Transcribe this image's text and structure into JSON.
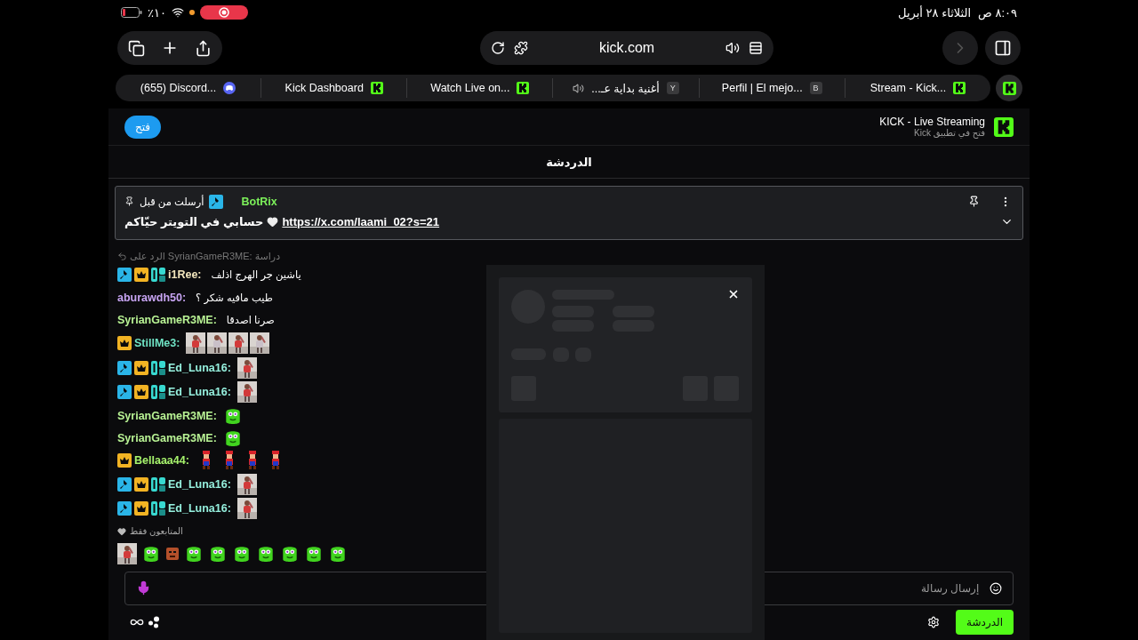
{
  "status_bar": {
    "time": "٨:٠٩ ص",
    "date": "الثلاثاء ٢٨ أبريل",
    "battery": "٪١٠",
    "recording": true
  },
  "toolbar": {
    "address": "kick.com",
    "forward_disabled": true
  },
  "tabs": [
    {
      "title": "Stream - Kick...",
      "audio": false,
      "favicon": {
        "kind": "kick"
      }
    },
    {
      "title": "Perfil | El mejo...",
      "audio": false,
      "favicon": {
        "kind": "letter",
        "text": "B"
      }
    },
    {
      "title": "أغنية بداية عـ...",
      "audio": true,
      "favicon": {
        "kind": "letter",
        "text": "Y"
      }
    },
    {
      "title": "Watch Live on...",
      "audio": false,
      "favicon": {
        "kind": "kick"
      }
    },
    {
      "title": "Kick Dashboard",
      "audio": false,
      "favicon": {
        "kind": "kick"
      }
    },
    {
      "title": "(655) Discord...",
      "audio": false,
      "favicon": {
        "kind": "discord"
      }
    }
  ],
  "app_banner": {
    "title": "KICK - Live Streaming",
    "subtitle": "فتح في تطبيق Kick",
    "button": "فتح"
  },
  "chat": {
    "title": "الدردشة",
    "pinned": {
      "sender_label": "أرسلت من قبل",
      "sender": {
        "name": "BotRix",
        "color": "#7cf05a",
        "badges": [
          {
            "kind": "mod"
          }
        ]
      },
      "text": "حسابي في التويتر حيّاكم",
      "link": "https://x.com/laami_02?s=21",
      "expanded": false
    },
    "messages": [
      {
        "user": "i1Ree:",
        "color": "#f3e6bd",
        "badges": [
          {
            "kind": "mod"
          },
          {
            "kind": "sub"
          },
          {
            "kind": "og"
          }
        ],
        "reply": "الرد على SyrianGameR3ME: دراسة",
        "content": [
          {
            "kind": "text",
            "text": "ياشين جر الهرج اذلف"
          }
        ]
      },
      {
        "user": "aburawdh50:",
        "color": "#c7a4f2",
        "content": [
          {
            "kind": "text",
            "text": "طيب مافيه شكر ؟"
          }
        ]
      },
      {
        "user": "SyrianGameR3ME:",
        "color": "#b8f294",
        "content": [
          {
            "kind": "text",
            "text": "صرنا اصدقا"
          }
        ]
      },
      {
        "user": "StillMe3:",
        "color": "#6fe3c4",
        "badges": [
          {
            "kind": "sub"
          }
        ],
        "content": [
          {
            "kind": "picture"
          },
          {
            "kind": "picture"
          },
          {
            "kind": "picture"
          },
          {
            "kind": "picture"
          }
        ]
      },
      {
        "user": "Ed_Luna16:",
        "color": "#95efdd",
        "badges": [
          {
            "kind": "mod"
          },
          {
            "kind": "sub"
          },
          {
            "kind": "og"
          }
        ],
        "content": [
          {
            "kind": "picture"
          }
        ]
      },
      {
        "user": "Ed_Luna16:",
        "color": "#95efdd",
        "badges": [
          {
            "kind": "mod"
          },
          {
            "kind": "sub"
          },
          {
            "kind": "og"
          }
        ],
        "content": [
          {
            "kind": "picture"
          }
        ]
      },
      {
        "user": "SyrianGameR3ME:",
        "color": "#b8f294",
        "content": [
          {
            "kind": "emote"
          }
        ]
      },
      {
        "user": "SyrianGameR3ME:",
        "color": "#b8f294",
        "content": [
          {
            "kind": "emote"
          }
        ]
      },
      {
        "user": "Bellaaa44:",
        "color": "#a6f26c",
        "badges": [
          {
            "kind": "sub"
          }
        ],
        "content": [
          {
            "kind": "sprite"
          },
          {
            "kind": "sprite"
          },
          {
            "kind": "sprite"
          },
          {
            "kind": "sprite"
          }
        ]
      },
      {
        "user": "Ed_Luna16:",
        "color": "#95efdd",
        "badges": [
          {
            "kind": "mod"
          },
          {
            "kind": "sub"
          },
          {
            "kind": "og"
          }
        ],
        "content": [
          {
            "kind": "picture"
          }
        ]
      },
      {
        "user": "Ed_Luna16:",
        "color": "#95efdd",
        "badges": [
          {
            "kind": "mod"
          },
          {
            "kind": "sub"
          },
          {
            "kind": "og"
          }
        ],
        "content": [
          {
            "kind": "picture"
          }
        ]
      }
    ],
    "followers_only": "المتابعون فقط",
    "emote_bar": [
      {
        "kind": "picture"
      },
      {
        "kind": "emote"
      },
      {
        "kind": "block"
      },
      {
        "kind": "emote"
      },
      {
        "kind": "emote"
      },
      {
        "kind": "emote"
      },
      {
        "kind": "emote"
      },
      {
        "kind": "emote"
      },
      {
        "kind": "emote"
      },
      {
        "kind": "emote"
      }
    ],
    "input": {
      "placeholder": "إرسال رسالة"
    },
    "send_button": "الدردشة"
  },
  "profile_card": {
    "loading": true
  }
}
